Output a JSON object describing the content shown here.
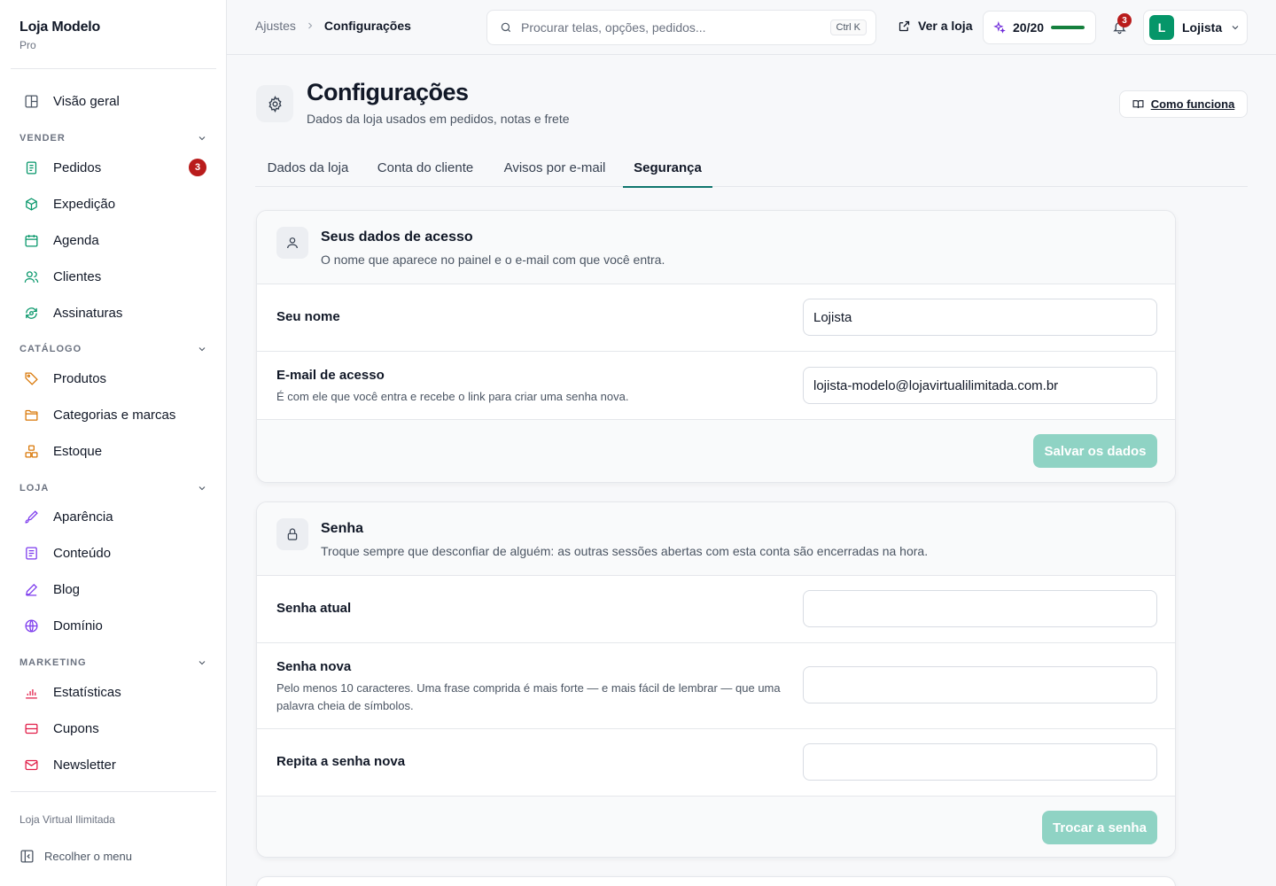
{
  "sidebar": {
    "brand_name": "Loja Modelo",
    "brand_plan": "Pro",
    "overview": "Visão geral",
    "sections": {
      "vender": "VENDER",
      "catalogo": "CATÁLOGO",
      "loja": "LOJA",
      "marketing": "MARKETING"
    },
    "items": {
      "pedidos": "Pedidos",
      "pedidos_badge": "3",
      "expedicao": "Expedição",
      "agenda": "Agenda",
      "clientes": "Clientes",
      "assinaturas": "Assinaturas",
      "produtos": "Produtos",
      "categorias": "Categorias e marcas",
      "estoque": "Estoque",
      "aparencia": "Aparência",
      "conteudo": "Conteúdo",
      "blog": "Blog",
      "dominio": "Domínio",
      "estatisticas": "Estatísticas",
      "cupons": "Cupons",
      "newsletter": "Newsletter"
    },
    "footer_store": "Loja Virtual Ilimitada",
    "collapse": "Recolher o menu"
  },
  "topbar": {
    "breadcrumb_parent": "Ajustes",
    "breadcrumb_current": "Configurações",
    "search_placeholder": "Procurar telas, opções, pedidos...",
    "search_shortcut": "Ctrl K",
    "view_store": "Ver a loja",
    "quota_text": "20/20",
    "quota_fraction": 1.0,
    "notifications_count": "3",
    "user_initial": "L",
    "user_name": "Lojista"
  },
  "page": {
    "title": "Configurações",
    "subtitle": "Dados da loja usados em pedidos, notas e frete",
    "help_button": "Como funciona"
  },
  "tabs": [
    "Dados da loja",
    "Conta do cliente",
    "Avisos por e-mail",
    "Segurança"
  ],
  "active_tab": "Segurança",
  "access_card": {
    "title": "Seus dados de acesso",
    "subtitle": "O nome que aparece no painel e o e-mail com que você entra.",
    "name_label": "Seu nome",
    "name_value": "Lojista",
    "email_label": "E-mail de acesso",
    "email_hint": "É com ele que você entra e recebe o link para criar uma senha nova.",
    "email_value": "lojista-modelo@lojavirtualilimitada.com.br",
    "save_button": "Salvar os dados"
  },
  "password_card": {
    "title": "Senha",
    "subtitle": "Troque sempre que desconfiar de alguém: as outras sessões abertas com esta conta são encerradas na hora.",
    "current_label": "Senha atual",
    "new_label": "Senha nova",
    "new_hint": "Pelo menos 10 caracteres. Uma frase comprida é mais forte — e mais fácil de lembrar — que uma palavra cheia de símbolos.",
    "repeat_label": "Repita a senha nova",
    "change_button": "Trocar a senha"
  },
  "colors": {
    "accent": "#0f766e",
    "primary_disabled": "#8fd3c4",
    "badge": "#b91c1c",
    "quota_fill": "#15803d",
    "avatar": "#059669"
  }
}
